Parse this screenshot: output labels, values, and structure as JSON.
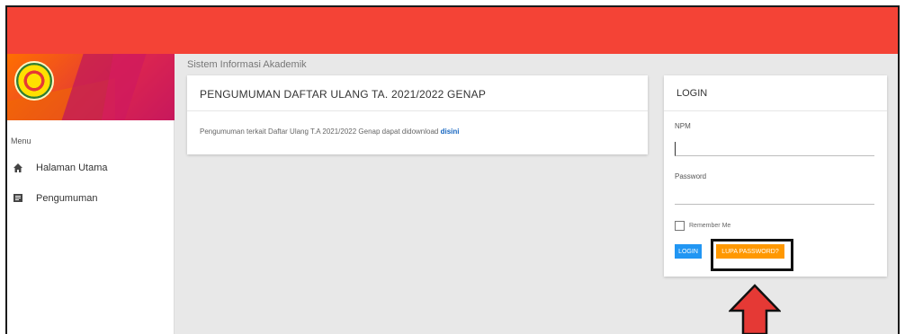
{
  "app": {
    "subtitle": "Sistem Informasi Akademik"
  },
  "sidebar": {
    "menu_heading": "Menu",
    "items": [
      {
        "label": "Halaman Utama",
        "icon": "home-icon"
      },
      {
        "label": "Pengumuman",
        "icon": "announcement-icon"
      }
    ]
  },
  "announcement": {
    "title": "PENGUMUMAN DAFTAR ULANG TA. 2021/2022 GENAP",
    "text": "Pengumuman terkait Daftar Ulang T.A 2021/2022 Genap dapat didownload ",
    "link": "disini"
  },
  "login": {
    "title": "LOGIN",
    "npm_label": "NPM",
    "npm_value": "",
    "password_label": "Password",
    "password_value": "",
    "remember_label": "Remember Me",
    "login_button": "LOGIN",
    "forgot_button": "LUPA PASSWORD?"
  },
  "colors": {
    "topbar": "#f44336",
    "login_button": "#2196f3",
    "forgot_button": "#ff9800",
    "arrow": "#e53935"
  }
}
